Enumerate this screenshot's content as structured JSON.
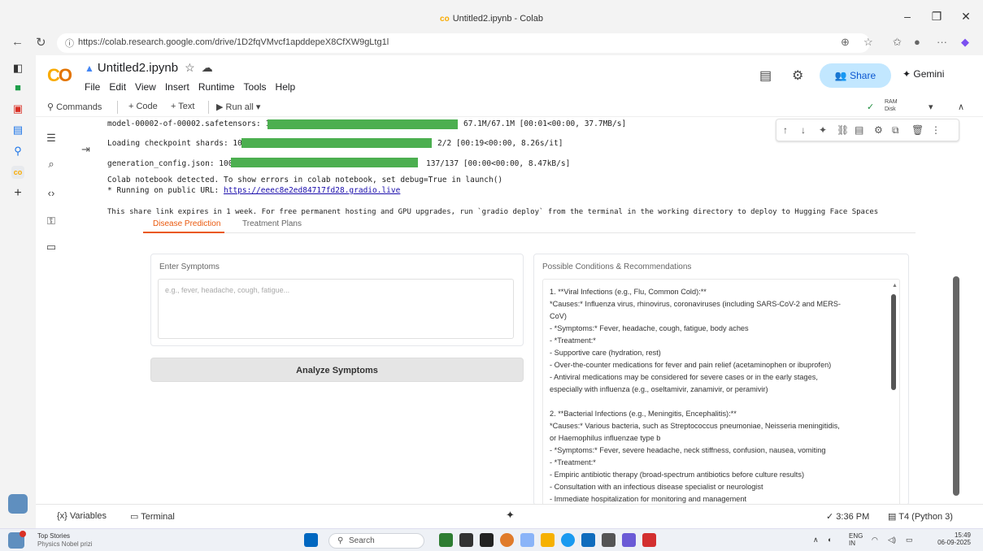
{
  "window": {
    "title": "Untitled2.ipynb - Colab",
    "logo_glyph": "co"
  },
  "browser": {
    "url": "https://colab.research.google.com/drive/1D2fqVMvcf1apddepeX8CfXW9gLtg1l"
  },
  "colab": {
    "notebook_title": "Untitled2.ipynb",
    "menu": [
      "File",
      "Edit",
      "View",
      "Insert",
      "Runtime",
      "Tools",
      "Help"
    ],
    "share_label": "Share",
    "gemini_label": "Gemini",
    "toolbar": {
      "commands": "Commands",
      "code": "+ Code",
      "text": "+ Text",
      "run_all": "Run all",
      "ram": "RAM",
      "disk": "Disk"
    }
  },
  "cell_output": {
    "lines": [
      "model-00002-of-00002.safetensors: 100%",
      "67.1M/67.1M [00:01<00:00, 37.7MB/s]",
      "Loading checkpoint shards: 100%",
      "2/2 [00:19<00:00,  8.26s/it]",
      "generation_config.json: 100%",
      "137/137 [00:00<00:00, 8.47kB/s]",
      "Colab notebook detected. To show errors in colab notebook, set debug=True in launch()",
      "* Running on public URL: ",
      "https://eeec8e2ed84717fd28.gradio.live",
      "This share link expires in 1 week. For free permanent hosting and GPU upgrades, run `gradio deploy` from the terminal in the working directory to deploy to Hugging Face Spaces"
    ]
  },
  "gradio": {
    "tabs": [
      "Disease Prediction",
      "Treatment Plans"
    ],
    "input_label": "Enter Symptoms",
    "input_placeholder": "e.g., fever, headache, cough, fatigue...",
    "analyze_button": "Analyze Symptoms",
    "output_label": "Possible Conditions & Recommendations",
    "output_lines": [
      "1. **Viral Infections (e.g., Flu, Common Cold):**",
      "   *Causes:* Influenza virus, rhinovirus, coronaviruses (including SARS-CoV-2 and MERS-",
      "CoV)",
      "  - *Symptoms:* Fever, headache, cough, fatigue, body aches",
      "  - *Treatment:*",
      "    - Supportive care (hydration, rest)",
      "    - Over-the-counter medications for fever and pain relief (acetaminophen or ibuprofen)",
      "    - Antiviral medications may be considered for severe cases or in the early stages,",
      "especially with influenza (e.g., oseltamivir, zanamivir, or peramivir)",
      "",
      "2. **Bacterial Infections (e.g., Meningitis, Encephalitis):**",
      "   *Causes:* Various bacteria, such as Streptococcus pneumoniae, Neisseria meningitidis,",
      "or Haemophilus influenzae type b",
      "  - *Symptoms:* Fever, severe headache, neck stiffness, confusion, nausea, vomiting",
      "  - *Treatment:*",
      "    - Empiric antibiotic therapy (broad-spectrum antibiotics before culture results)",
      "    - Consultation with an infectious disease specialist or neurologist",
      "    - Immediate hospitalization for monitoring and management"
    ]
  },
  "statusbar": {
    "variables": "Variables",
    "terminal": "Terminal",
    "time": "3:36 PM",
    "runtime": "T4 (Python 3)"
  },
  "taskbar": {
    "news_title": "Top Stories",
    "news_sub": "Physics Nobel prizi",
    "search": "Search",
    "lang1": "ENG",
    "lang2": "IN",
    "clock_time": "15:49",
    "clock_date": "06-09-2025"
  }
}
